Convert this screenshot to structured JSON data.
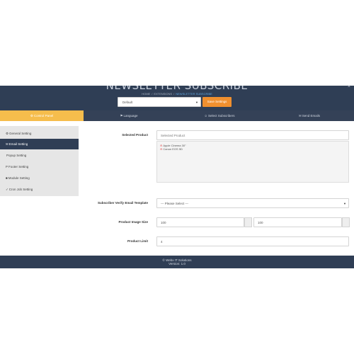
{
  "header": {
    "title": "NEWSLETTER SUBSCRIBE",
    "breadcrumb": [
      "HOME",
      "EXTENSIONS",
      "NEWSLETTER SUBSCRIBE"
    ],
    "close": "×",
    "store_select": "Default",
    "save_label": "Save Settings"
  },
  "tabs": [
    {
      "icon": "⚙",
      "label": "Control Panel"
    },
    {
      "icon": "⚑",
      "label": "Language"
    },
    {
      "icon": "☺",
      "label": "Select Subscribers"
    },
    {
      "icon": "✉",
      "label": "Send Emails"
    }
  ],
  "sidebar": {
    "items": [
      {
        "icon": "⚙",
        "label": "General Setting"
      },
      {
        "icon": "✉",
        "label": "Email Setting"
      },
      {
        "icon": "",
        "label": "Popup Setting"
      },
      {
        "icon": "P",
        "label": "Footer Setting"
      },
      {
        "icon": "■",
        "label": "Module Setting"
      },
      {
        "icon": "✓",
        "label": "Cron Job Setting"
      }
    ]
  },
  "form": {
    "selected_product_label": "Selected Product",
    "selected_product_placeholder": "Selected Product",
    "products": [
      "Apple Cinema 30\"",
      "Canon EOS 5D"
    ],
    "verify_template_label": "Subscriber Verify Email Template",
    "verify_template_value": "--- Please Select ---",
    "image_size_label": "Product Image Size",
    "image_width": "100",
    "image_height": "100",
    "limit_label": "Product Limit",
    "limit_value": "4"
  },
  "footer": {
    "line1": "© Webx IT Solutions",
    "line2": "Version: 1.0"
  },
  "colors": {
    "header_bg": "#2f3e55",
    "accent_orange": "#f0902f",
    "active_tab": "#f6bd4c"
  }
}
